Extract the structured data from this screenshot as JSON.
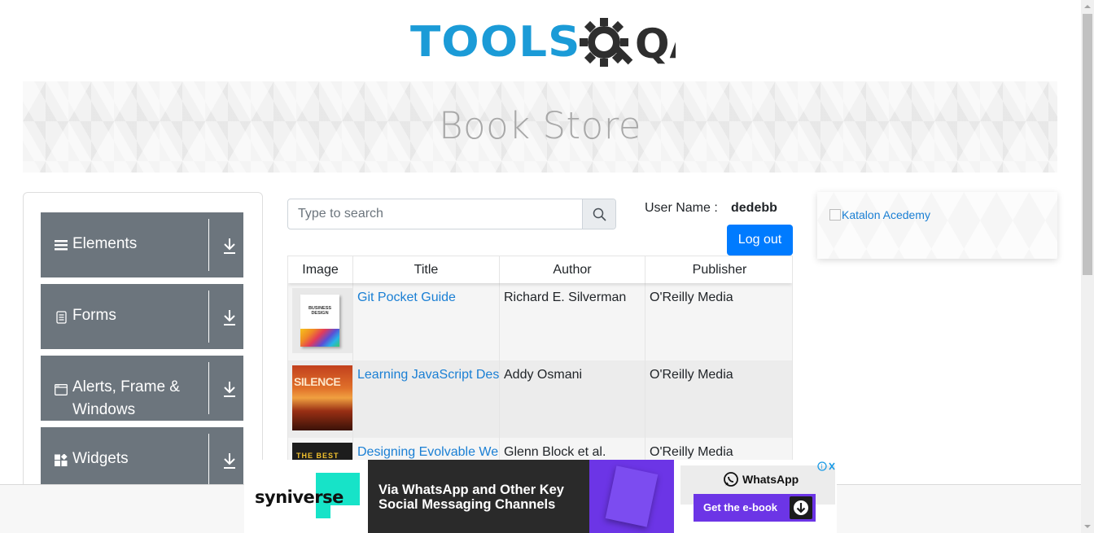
{
  "header": {
    "logo_text": "TOOLS",
    "logo_suffix": "QA"
  },
  "banner": {
    "title": "Book Store"
  },
  "sidebar": {
    "groups": [
      {
        "label": "Elements",
        "icon": "hamburger-icon"
      },
      {
        "label": "Forms",
        "icon": "document-icon"
      },
      {
        "label": "Alerts, Frame & Windows",
        "icon": "window-icon"
      },
      {
        "label": "Widgets",
        "icon": "widgets-icon"
      }
    ]
  },
  "search": {
    "placeholder": "Type to search",
    "value": ""
  },
  "user": {
    "label": "User Name :",
    "value": "dedebb",
    "logout_label": "Log out"
  },
  "table": {
    "columns": [
      "Image",
      "Title",
      "Author",
      "Publisher"
    ],
    "rows": [
      {
        "cover_text": "BUSINESS DESIGN",
        "title": "Git Pocket Guide",
        "author": "Richard E. Silverman",
        "publisher": "O'Reilly Media"
      },
      {
        "cover_text": "SILENCE",
        "title": "Learning JavaScript Design Patterns",
        "author": "Addy Osmani",
        "publisher": "O'Reilly Media"
      },
      {
        "cover_text": "THE BEST",
        "title": "Designing Evolvable Web APIs with ASP.NET",
        "author": "Glenn Block et al.",
        "publisher": "O'Reilly Media"
      }
    ]
  },
  "side_ad": {
    "alt_text": "Katalon Acedemy"
  },
  "bottom_ad": {
    "brand": "syniverse",
    "headline": "Via WhatsApp and Other Key Social Messaging Channels",
    "whatsapp_label": "WhatsApp",
    "cta_label": "Get the e-book",
    "colors": {
      "brand_accent": "#17e3c8",
      "purple": "#6c35e6"
    }
  },
  "colors": {
    "primary": "#007bff",
    "sidebar_group": "#6c757d",
    "logo_blue": "#1b9bd7",
    "logo_dark": "#2e2e2e",
    "link": "#1a7fd4"
  }
}
